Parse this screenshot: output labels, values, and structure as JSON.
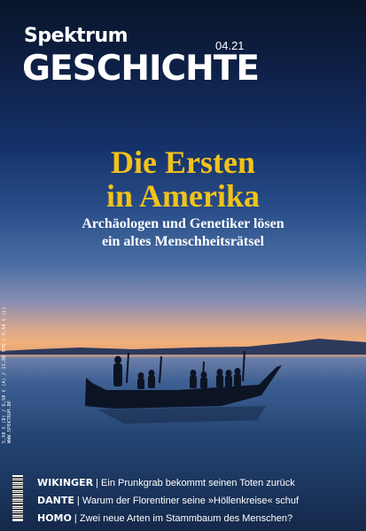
{
  "masthead": {
    "brand": "Spektrum",
    "series": "GESCHICHTE",
    "issue": "04.21"
  },
  "headline": {
    "line1": "Die Ersten",
    "line2": "in Amerika"
  },
  "subheadline": {
    "line1": "Archäologen und Genetiker lösen",
    "line2": "ein altes Menschheitsrätsel"
  },
  "spine_text": {
    "price": "5,90 € (D) / 6,50 € (A) / 11,80 SFR / 6,50 € (L)",
    "url": "WWW.SPEKTRUM.DE"
  },
  "teasers": [
    {
      "keyword": "WIKINGER",
      "separator": " | ",
      "text": "Ein Prunkgrab bekommt seinen Toten zurück"
    },
    {
      "keyword": "DANTE",
      "separator": " | ",
      "text": "Warum der Florentiner seine »Höllenkreise« schuf"
    },
    {
      "keyword": "HOMO",
      "separator": " | ",
      "text": "Zwei neue Arten im Stammbaum des Menschen?"
    }
  ],
  "colors": {
    "headline": "#f2c21a",
    "text": "#ffffff",
    "sky_top": "#091529",
    "horizon": "#f0b07a",
    "water": "#244574"
  }
}
